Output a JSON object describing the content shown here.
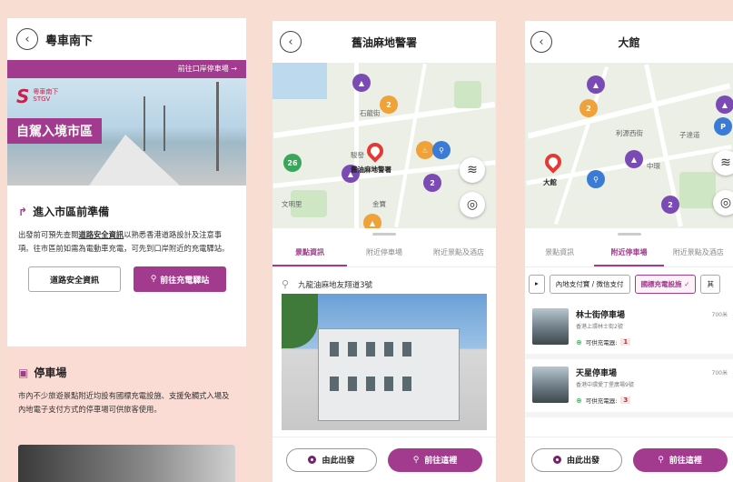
{
  "screen1": {
    "title": "粵車南下",
    "banner_link": "前往口岸停車場 →",
    "logo_text_cn": "粵車南下",
    "logo_text_en": "STGV",
    "banner_tag": "自駕入境市區",
    "section1": {
      "heading": "進入市區前準備",
      "para_before": "出發前可預先查閱",
      "para_link": "道路安全資訊",
      "para_after": "以熟悉香港道路設計及注意事項。往市區前如需為電動車充電，可先到口岸附近的充電驛站。",
      "btn_safety": "道路安全資訊",
      "btn_charge": "前往充電驛站"
    },
    "section2": {
      "heading": "停車場",
      "para": "市內不少旅遊景點附近均設有國標充電設施、支援免觸式入場及內地電子支付方式的停車場可供旅客使用。"
    }
  },
  "screen2": {
    "title": "舊油麻地警署",
    "map_label": "舊油麻地警署",
    "map_small_labels": [
      "石龍街",
      "駿發",
      "文明里",
      "金寶"
    ],
    "tabs": [
      "景點資訊",
      "附近停車場",
      "附近景點及酒店"
    ],
    "active_tab": 0,
    "address": "九龍油麻地友翔道3號",
    "btn_depart": "由此出發",
    "btn_go": "前往這裡",
    "pins": [
      {
        "label": "2"
      },
      {
        "label": "26"
      },
      {
        "label": "2"
      }
    ]
  },
  "screen3": {
    "title": "大館",
    "map_label": "大館",
    "map_small_labels": [
      "中環",
      "子達道",
      "利源西街"
    ],
    "tabs": [
      "景點資訊",
      "附近停車場",
      "附近景點及酒店"
    ],
    "active_tab": 1,
    "chips": [
      "",
      "內地支付寶 / 微信支付",
      "國標充電設施 ✓",
      "其"
    ],
    "carparks": [
      {
        "name": "林士街停車場",
        "address": "香港上環林士街2號",
        "distance": "700米",
        "ev_label": "可供充電器:",
        "ev_count": "1"
      },
      {
        "name": "天星停車場",
        "address": "香港中環愛丁堡廣場9號",
        "distance": "700米",
        "ev_label": "可供充電器:",
        "ev_count": "3"
      }
    ],
    "btn_depart": "由此出發",
    "btn_go": "前往這裡"
  }
}
